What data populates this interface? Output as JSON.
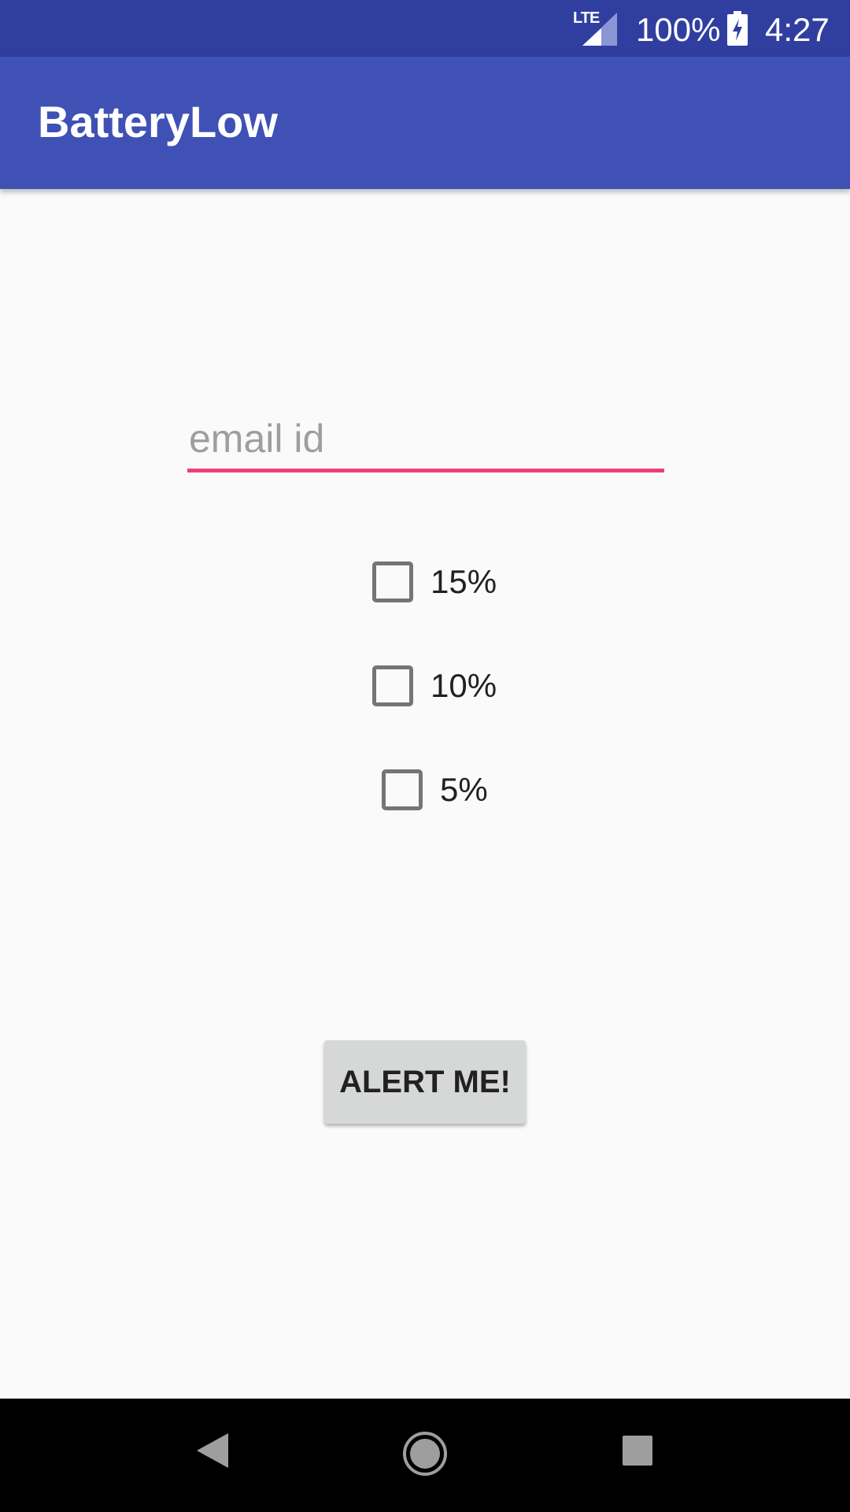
{
  "status_bar": {
    "network": "LTE",
    "battery_percent": "100%",
    "time": "4:27",
    "icons": [
      "lte-signal-icon",
      "battery-charging-icon"
    ]
  },
  "app_bar": {
    "title": "BatteryLow"
  },
  "form": {
    "email": {
      "placeholder": "email id",
      "value": ""
    },
    "thresholds": [
      {
        "label": "15%",
        "checked": false
      },
      {
        "label": "10%",
        "checked": false
      },
      {
        "label": "5%",
        "checked": false
      }
    ],
    "submit_label": "ALERT ME!"
  },
  "nav_bar": {
    "icons": [
      "back-icon",
      "home-icon",
      "recents-icon"
    ]
  },
  "colors": {
    "status_bar": "#303f9f",
    "app_bar": "#3f51b5",
    "accent": "#ec407a",
    "background": "#fafafa",
    "button": "#d6d7d7"
  }
}
